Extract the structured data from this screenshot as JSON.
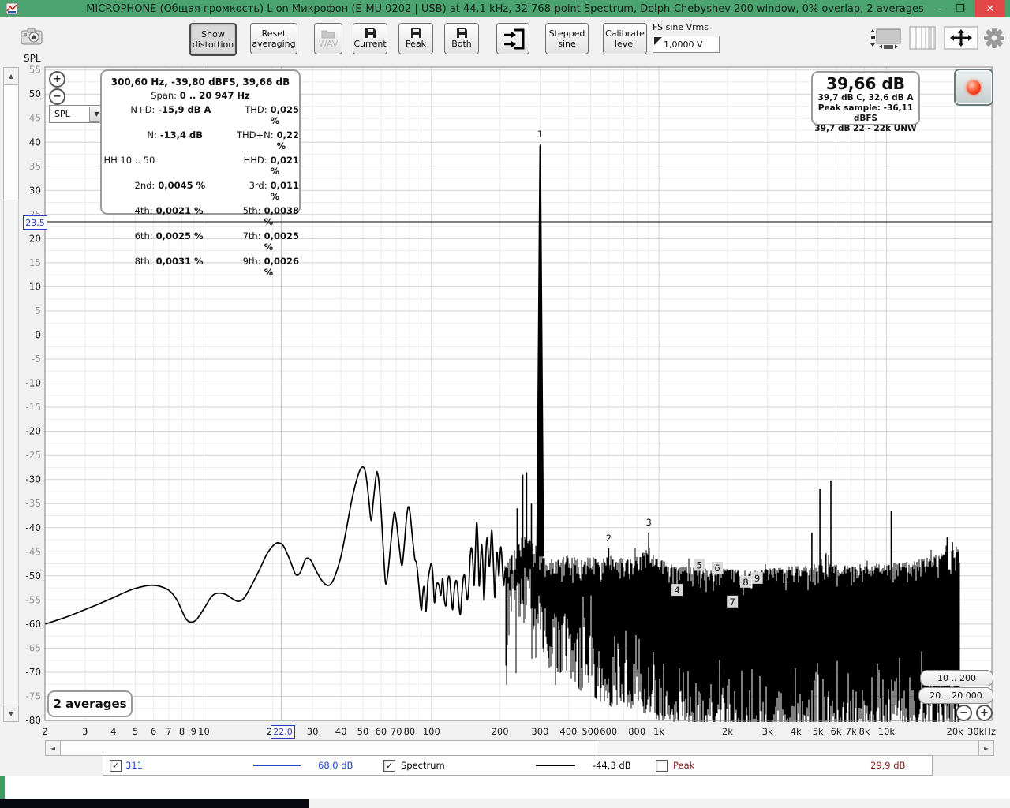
{
  "window": {
    "title": "MICROPHONE (Общая громкость) L on Микрофон (E-MU 0202 | USB) at 44.1 kHz, 32 768-point Spectrum, Dolph-Chebyshev 200 window, 0% overlap, 2 averages"
  },
  "icons": {
    "check": "✓",
    "plus": "+",
    "minus": "−",
    "up": "▲",
    "down": "▼",
    "left": "◄",
    "right": "►",
    "dropdown": "▼",
    "close": "✕",
    "minimize": "–",
    "maximize": "❐"
  },
  "toolbar": {
    "show_distortion": "Show distortion",
    "reset_averaging": "Reset averaging",
    "wav": "WAV",
    "current": "Current",
    "peak": "Peak",
    "both": "Both",
    "stepped_sine": "Stepped sine",
    "calibrate_level": "Calibrate level",
    "fs_sine_label": "FS sine Vrms",
    "fs_sine_value": "1,0000 V"
  },
  "info_box": {
    "line1": "300,60 Hz, -39,80 dBFS, 39,66 dB",
    "span_label": "Span:",
    "span_value": "0 .. 20 947 Hz",
    "rows": [
      {
        "l": "N+D:",
        "v": "-15,9 dB A",
        "l2": "THD:",
        "v2": "0,025 %"
      },
      {
        "l": "N:",
        "v": "-13,4 dB",
        "l2": "THD+N:",
        "v2": "0,22 %"
      },
      {
        "l": "HH 10 .. 50",
        "v": "",
        "l2": "HHD:",
        "v2": "0,021 %"
      },
      {
        "l": "2nd:",
        "v": "0,0045 %",
        "l2": "3rd:",
        "v2": "0,011 %"
      },
      {
        "l": "4th:",
        "v": "0,0021 %",
        "l2": "5th:",
        "v2": "0,0038 %"
      },
      {
        "l": "6th:",
        "v": "0,0025 %",
        "l2": "7th:",
        "v2": "0,0025 %"
      },
      {
        "l": "8th:",
        "v": "0,0031 %",
        "l2": "9th:",
        "v2": "0,0026 %"
      }
    ]
  },
  "level_box": {
    "big": "39,66 dB",
    "line2": "39,7 dB C, 32,6 dB A",
    "line3": "Peak sample: -36,11 dBFS",
    "line4": "39,7 dB 22 - 22k UNW"
  },
  "overlays": {
    "averages": "2 averages",
    "range1": "10 .. 200",
    "range2": "20 .. 20 000",
    "spl_dropdown": "SPL",
    "spl_axis_label": "SPL"
  },
  "cursor_boxes": {
    "y_value": "23,5",
    "x_value": "22,0"
  },
  "legend": [
    {
      "checked": true,
      "label": "311",
      "value": "68,0 dB",
      "color": "#2244cc"
    },
    {
      "checked": true,
      "label": "Spectrum",
      "value": "-44,3 dB",
      "color": "#000000"
    },
    {
      "checked": false,
      "label": "Peak",
      "value": "29,9 dB",
      "color": "#8b1a1a"
    }
  ],
  "chart_data": {
    "type": "line",
    "title": "Spectrum, Dolph-Chebyshev 200 window, 0% overlap, 2 averages",
    "ylabel": "SPL (dB)",
    "x_scale": "log",
    "xlim": [
      2,
      30000
    ],
    "ylim": [
      -80,
      55.6
    ],
    "y_tick_step": 5,
    "data_span_hz": [
      0,
      20947
    ],
    "fundamental": {
      "freq_hz": 300.6,
      "level_dbfs": -39.8,
      "level_db": 39.66
    },
    "cursor": {
      "x_hz": 22.0,
      "y_db": 23.5
    },
    "x_ticks": [
      [
        "2",
        2
      ],
      [
        "3",
        3
      ],
      [
        "4",
        4
      ],
      [
        "5",
        5
      ],
      [
        "6",
        6
      ],
      [
        "7",
        7
      ],
      [
        "8",
        8
      ],
      [
        "9",
        9
      ],
      [
        "10",
        10
      ],
      [
        "20",
        20
      ],
      [
        "30",
        30
      ],
      [
        "40",
        40
      ],
      [
        "50",
        50
      ],
      [
        "60",
        60
      ],
      [
        "70",
        70
      ],
      [
        "80",
        80
      ],
      [
        "100",
        100
      ],
      [
        "200",
        200
      ],
      [
        "300",
        300
      ],
      [
        "400",
        400
      ],
      [
        "500",
        500
      ],
      [
        "600",
        600
      ],
      [
        "800",
        800
      ],
      [
        "1k",
        1000
      ],
      [
        "2k",
        2000
      ],
      [
        "3k",
        3000
      ],
      [
        "4k",
        4000
      ],
      [
        "5k",
        5000
      ],
      [
        "6k",
        6000
      ],
      [
        "7k",
        7000
      ],
      [
        "8k",
        8000
      ],
      [
        "10k",
        10000
      ],
      [
        "20k",
        20000
      ],
      [
        "30kHz",
        30000
      ]
    ],
    "curve_db": [
      [
        2,
        -60
      ],
      [
        2.5,
        -58.5
      ],
      [
        3,
        -57
      ],
      [
        3.5,
        -55.7
      ],
      [
        4,
        -54.5
      ],
      [
        4.5,
        -53.4
      ],
      [
        5,
        -52.6
      ],
      [
        5.7,
        -52
      ],
      [
        6.3,
        -52.1
      ],
      [
        7,
        -53
      ],
      [
        7.6,
        -55
      ],
      [
        8.3,
        -58.8
      ],
      [
        8.8,
        -59.6
      ],
      [
        9.3,
        -59
      ],
      [
        10,
        -56.8
      ],
      [
        10.8,
        -54.3
      ],
      [
        11.5,
        -53.6
      ],
      [
        12.5,
        -53.9
      ],
      [
        13.5,
        -54.9
      ],
      [
        14.2,
        -55.3
      ],
      [
        15,
        -54.6
      ],
      [
        16,
        -52.4
      ],
      [
        17.5,
        -48.8
      ],
      [
        19,
        -45.3
      ],
      [
        20.5,
        -43.4
      ],
      [
        21.5,
        -43.2
      ],
      [
        22.5,
        -44
      ],
      [
        24,
        -47
      ],
      [
        25.3,
        -49.7
      ],
      [
        26.5,
        -49.3
      ],
      [
        28,
        -46.5
      ],
      [
        29.5,
        -46.8
      ],
      [
        31,
        -48.8
      ],
      [
        33,
        -51
      ],
      [
        35,
        -52
      ],
      [
        36.5,
        -51.4
      ],
      [
        38,
        -49.5
      ],
      [
        40,
        -46
      ],
      [
        42,
        -41
      ],
      [
        45,
        -33.5
      ],
      [
        48,
        -28.6
      ],
      [
        50,
        -27.4
      ],
      [
        51.5,
        -29
      ],
      [
        53,
        -34
      ],
      [
        54.3,
        -38.5
      ],
      [
        55.5,
        -34.5
      ],
      [
        57,
        -29.5
      ],
      [
        57.8,
        -28.5
      ],
      [
        59,
        -31.5
      ],
      [
        60.5,
        -39
      ],
      [
        62,
        -48
      ],
      [
        63,
        -51.7
      ],
      [
        64.5,
        -49
      ],
      [
        66.5,
        -42.5
      ],
      [
        68.5,
        -37
      ],
      [
        70,
        -38.5
      ],
      [
        72,
        -43.5
      ],
      [
        74,
        -47.8
      ],
      [
        75.5,
        -45
      ],
      [
        77.5,
        -38.5
      ],
      [
        79,
        -35.7
      ],
      [
        80.5,
        -37
      ],
      [
        82.5,
        -42
      ],
      [
        84.5,
        -46.5
      ],
      [
        86,
        -47.4
      ],
      [
        88,
        -52
      ],
      [
        89.5,
        -56
      ],
      [
        90.5,
        -57
      ],
      [
        91.5,
        -54
      ],
      [
        92.5,
        -52.2
      ],
      [
        93.5,
        -54
      ],
      [
        94.5,
        -57.4
      ],
      [
        95.5,
        -55
      ],
      [
        96.5,
        -51
      ],
      [
        98,
        -49
      ],
      [
        100,
        -47.4
      ],
      [
        101.5,
        -50
      ],
      [
        103,
        -55.5
      ],
      [
        104.5,
        -53
      ],
      [
        106,
        -51.5
      ],
      [
        108,
        -52
      ],
      [
        110,
        -54
      ],
      [
        112,
        -50.5
      ],
      [
        114,
        -55
      ],
      [
        116,
        -56
      ],
      [
        118,
        -51
      ],
      [
        120,
        -50.3
      ],
      [
        122,
        -54
      ],
      [
        124,
        -57
      ],
      [
        126,
        -53
      ],
      [
        128,
        -51
      ],
      [
        130,
        -52
      ],
      [
        132,
        -56
      ],
      [
        134,
        -58
      ],
      [
        136,
        -54
      ],
      [
        138,
        -50.5
      ],
      [
        140,
        -50
      ],
      [
        142,
        -53
      ],
      [
        144,
        -55
      ],
      [
        146,
        -52
      ],
      [
        148,
        -46
      ],
      [
        150,
        -44.2
      ],
      [
        152,
        -47
      ],
      [
        154,
        -52
      ],
      [
        156,
        -45
      ],
      [
        158,
        -38.9
      ],
      [
        160,
        -43
      ],
      [
        162,
        -52
      ],
      [
        164,
        -48
      ],
      [
        166,
        -43.5
      ],
      [
        168,
        -47
      ],
      [
        170,
        -55
      ],
      [
        172,
        -51
      ],
      [
        174,
        -44
      ],
      [
        176,
        -42.2
      ],
      [
        178,
        -46
      ],
      [
        180,
        -48
      ],
      [
        182,
        -44
      ],
      [
        184,
        -40.5
      ],
      [
        186,
        -44
      ],
      [
        188,
        -50
      ],
      [
        190,
        -54.5
      ],
      [
        192,
        -49
      ],
      [
        194,
        -45.2
      ],
      [
        196,
        -47
      ],
      [
        198,
        -50
      ],
      [
        200,
        -46
      ],
      [
        202,
        -44
      ],
      [
        204,
        -46.5
      ],
      [
        206,
        -50
      ],
      [
        208,
        -52
      ],
      [
        210,
        -49
      ]
    ],
    "noise_top_db": [
      [
        210,
        -48
      ],
      [
        230,
        -45
      ],
      [
        245,
        -42
      ],
      [
        260,
        -41.5
      ],
      [
        280,
        -43
      ],
      [
        300,
        -45
      ],
      [
        320,
        -46.5
      ],
      [
        350,
        -47
      ],
      [
        400,
        -45.5
      ],
      [
        450,
        -46.5
      ],
      [
        500,
        -46
      ],
      [
        560,
        -46.5
      ],
      [
        620,
        -45.5
      ],
      [
        700,
        -46.5
      ],
      [
        800,
        -46
      ],
      [
        900,
        -44
      ],
      [
        1000,
        -46.5
      ],
      [
        1200,
        -48
      ],
      [
        1400,
        -48
      ],
      [
        1700,
        -48.5
      ],
      [
        2000,
        -48.5
      ],
      [
        2500,
        -49
      ],
      [
        3000,
        -48.5
      ],
      [
        3500,
        -48
      ],
      [
        4000,
        -48
      ],
      [
        5000,
        -47.5
      ],
      [
        6000,
        -47.5
      ],
      [
        7000,
        -48
      ],
      [
        8000,
        -48
      ],
      [
        9000,
        -47.5
      ],
      [
        10000,
        -47.5
      ],
      [
        12000,
        -47
      ],
      [
        14000,
        -46.5
      ],
      [
        16000,
        -46
      ],
      [
        18000,
        -45
      ],
      [
        20000,
        -44.5
      ],
      [
        20947,
        -44.5
      ]
    ],
    "noise_bottom_db": [
      [
        210,
        -57
      ],
      [
        230,
        -59
      ],
      [
        250,
        -61
      ],
      [
        270,
        -60
      ],
      [
        290,
        -63
      ],
      [
        310,
        -66
      ],
      [
        330,
        -68
      ],
      [
        360,
        -70
      ],
      [
        400,
        -72
      ],
      [
        450,
        -74
      ],
      [
        500,
        -75
      ],
      [
        600,
        -77
      ],
      [
        700,
        -78
      ],
      [
        800,
        -78
      ],
      [
        900,
        -79
      ],
      [
        1000,
        -80
      ],
      [
        1500,
        -82
      ],
      [
        2000,
        -83
      ],
      [
        3000,
        -84
      ],
      [
        5000,
        -84
      ],
      [
        8000,
        -83
      ],
      [
        12000,
        -83
      ],
      [
        16000,
        -82
      ],
      [
        20947,
        -82
      ]
    ],
    "spikes_db": [
      [
        238,
        -36
      ],
      [
        252,
        -29
      ],
      [
        262,
        -28.5
      ],
      [
        275,
        -35
      ],
      [
        601,
        -44.3
      ],
      [
        902,
        -41
      ],
      [
        1202,
        -55
      ],
      [
        1503,
        -49.5
      ],
      [
        1804,
        -50
      ],
      [
        2104,
        -57
      ],
      [
        2405,
        -53
      ],
      [
        2705,
        -52
      ],
      [
        4700,
        -41
      ],
      [
        5100,
        -32
      ],
      [
        5700,
        -30.2
      ],
      [
        10500,
        -36.6
      ],
      [
        18500,
        -42
      ],
      [
        19500,
        -43
      ]
    ],
    "harmonic_markers": [
      {
        "n": "1",
        "f": 300.6,
        "db": 41.7,
        "boxed": false
      },
      {
        "n": "2",
        "f": 601,
        "db": -42.2,
        "boxed": false
      },
      {
        "n": "3",
        "f": 902,
        "db": -38.9,
        "boxed": false
      },
      {
        "n": "4",
        "f": 1202,
        "db": -53.0,
        "boxed": true
      },
      {
        "n": "5",
        "f": 1503,
        "db": -47.8,
        "boxed": true
      },
      {
        "n": "6",
        "f": 1804,
        "db": -48.4,
        "boxed": true
      },
      {
        "n": "7",
        "f": 2104,
        "db": -55.4,
        "boxed": true
      },
      {
        "n": "8",
        "f": 2405,
        "db": -51.3,
        "boxed": true
      },
      {
        "n": "9",
        "f": 2705,
        "db": -50.5,
        "boxed": true
      }
    ]
  }
}
